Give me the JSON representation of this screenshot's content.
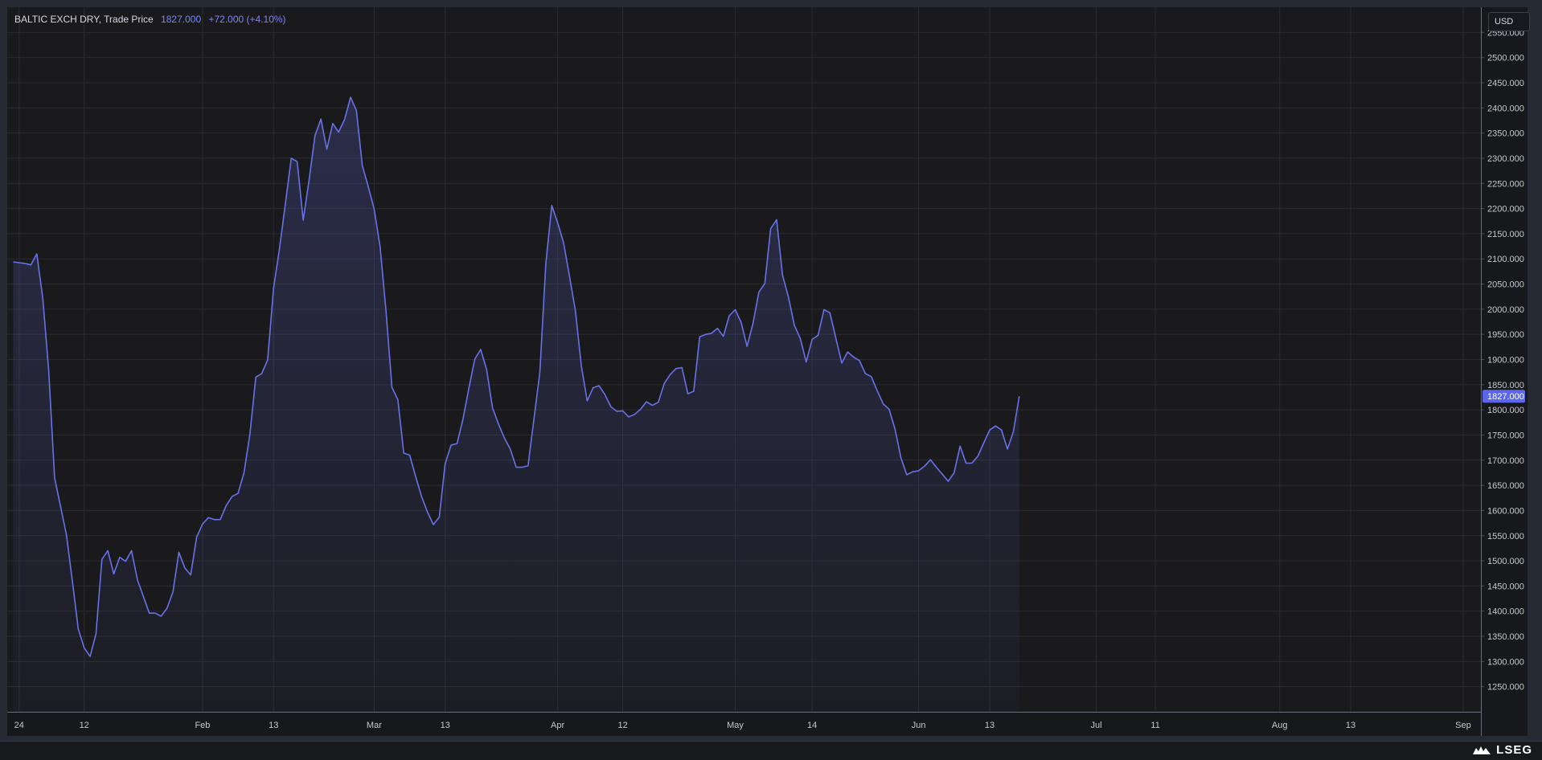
{
  "legend": {
    "symbol": "BALTIC EXCH DRY, Trade Price",
    "last": "1827.000",
    "change": "+72.000 (+4.10%)"
  },
  "currency": "USD",
  "last_price_tag": "1827.000",
  "brand": "LSEG",
  "colors": {
    "line": "#6872e8",
    "background": "#1a1a1d",
    "grid": "#2a2b31",
    "text": "#c4c8d0",
    "price_tag": "#5b66ea"
  },
  "chart_data": {
    "type": "area",
    "title": "BALTIC EXCH DRY, Trade Price",
    "ylabel": "",
    "xlabel": "",
    "ylim": [
      1200,
      2600
    ],
    "grid": true,
    "y_ticks": [
      "1250.000",
      "1300.000",
      "1350.000",
      "1400.000",
      "1450.000",
      "1500.000",
      "1550.000",
      "1600.000",
      "1650.000",
      "1700.000",
      "1750.000",
      "1800.000",
      "1850.000",
      "1900.000",
      "1950.000",
      "2000.000",
      "2050.000",
      "2100.000",
      "2150.000",
      "2200.000",
      "2250.000",
      "2300.000",
      "2350.000",
      "2400.000",
      "2450.000",
      "2500.000",
      "2550.000"
    ],
    "x_ticks": [
      {
        "label": "24",
        "date": "2024-01-01"
      },
      {
        "label": "12",
        "date": "2024-01-12"
      },
      {
        "label": "Feb",
        "date": "2024-02-01"
      },
      {
        "label": "13",
        "date": "2024-02-13"
      },
      {
        "label": "Mar",
        "date": "2024-03-01"
      },
      {
        "label": "13",
        "date": "2024-03-13"
      },
      {
        "label": "Apr",
        "date": "2024-04-01"
      },
      {
        "label": "12",
        "date": "2024-04-12"
      },
      {
        "label": "May",
        "date": "2024-05-01"
      },
      {
        "label": "14",
        "date": "2024-05-14"
      },
      {
        "label": "Jun",
        "date": "2024-06-01"
      },
      {
        "label": "13",
        "date": "2024-06-13"
      },
      {
        "label": "Jul",
        "date": "2024-07-01"
      },
      {
        "label": "11",
        "date": "2024-07-11"
      },
      {
        "label": "Aug",
        "date": "2024-08-01"
      },
      {
        "label": "13",
        "date": "2024-08-13"
      },
      {
        "label": "Sep",
        "date": "2024-09-01"
      }
    ],
    "x_range": [
      "2023-12-30",
      "2024-09-04"
    ],
    "series": [
      {
        "values": [
          [
            "2023-12-31",
            2094
          ],
          [
            "2024-01-02",
            2091
          ],
          [
            "2024-01-03",
            2088
          ],
          [
            "2024-01-04",
            2110
          ],
          [
            "2024-01-05",
            2022
          ],
          [
            "2024-01-06",
            1880
          ],
          [
            "2024-01-07",
            1665
          ],
          [
            "2024-01-09",
            1552
          ],
          [
            "2024-01-10",
            1460
          ],
          [
            "2024-01-11",
            1365
          ],
          [
            "2024-01-12",
            1327
          ],
          [
            "2024-01-13",
            1310
          ],
          [
            "2024-01-14",
            1355
          ],
          [
            "2024-01-15",
            1503
          ],
          [
            "2024-01-16",
            1520
          ],
          [
            "2024-01-17",
            1474
          ],
          [
            "2024-01-18",
            1507
          ],
          [
            "2024-01-19",
            1499
          ],
          [
            "2024-01-20",
            1520
          ],
          [
            "2024-01-21",
            1462
          ],
          [
            "2024-01-23",
            1396
          ],
          [
            "2024-01-24",
            1396
          ],
          [
            "2024-01-25",
            1390
          ],
          [
            "2024-01-26",
            1406
          ],
          [
            "2024-01-27",
            1438
          ],
          [
            "2024-01-28",
            1517
          ],
          [
            "2024-01-29",
            1486
          ],
          [
            "2024-01-30",
            1472
          ],
          [
            "2024-01-31",
            1547
          ],
          [
            "2024-02-01",
            1573
          ],
          [
            "2024-02-02",
            1586
          ],
          [
            "2024-02-03",
            1582
          ],
          [
            "2024-02-04",
            1582
          ],
          [
            "2024-02-05",
            1610
          ],
          [
            "2024-02-06",
            1628
          ],
          [
            "2024-02-07",
            1634
          ],
          [
            "2024-02-08",
            1675
          ],
          [
            "2024-02-09",
            1751
          ],
          [
            "2024-02-10",
            1865
          ],
          [
            "2024-02-11",
            1872
          ],
          [
            "2024-02-12",
            1899
          ],
          [
            "2024-02-13",
            2042
          ],
          [
            "2024-02-14",
            2120
          ],
          [
            "2024-02-15",
            2210
          ],
          [
            "2024-02-16",
            2300
          ],
          [
            "2024-02-17",
            2293
          ],
          [
            "2024-02-18",
            2177
          ],
          [
            "2024-02-19",
            2256
          ],
          [
            "2024-02-20",
            2345
          ],
          [
            "2024-02-21",
            2378
          ],
          [
            "2024-02-22",
            2318
          ],
          [
            "2024-02-23",
            2369
          ],
          [
            "2024-02-24",
            2352
          ],
          [
            "2024-02-25",
            2377
          ],
          [
            "2024-02-26",
            2421
          ],
          [
            "2024-02-27",
            2395
          ],
          [
            "2024-02-28",
            2285
          ],
          [
            "2024-02-29",
            2244
          ],
          [
            "2024-03-01",
            2199
          ],
          [
            "2024-03-02",
            2124
          ],
          [
            "2024-03-03",
            1997
          ],
          [
            "2024-03-04",
            1845
          ],
          [
            "2024-03-05",
            1820
          ],
          [
            "2024-03-06",
            1714
          ],
          [
            "2024-03-07",
            1710
          ],
          [
            "2024-03-08",
            1668
          ],
          [
            "2024-03-09",
            1628
          ],
          [
            "2024-03-10",
            1597
          ],
          [
            "2024-03-11",
            1572
          ],
          [
            "2024-03-12",
            1587
          ],
          [
            "2024-03-13",
            1693
          ],
          [
            "2024-03-14",
            1730
          ],
          [
            "2024-03-15",
            1733
          ],
          [
            "2024-03-16",
            1781
          ],
          [
            "2024-03-17",
            1843
          ],
          [
            "2024-03-18",
            1901
          ],
          [
            "2024-03-19",
            1920
          ],
          [
            "2024-03-20",
            1880
          ],
          [
            "2024-03-21",
            1804
          ],
          [
            "2024-03-22",
            1772
          ],
          [
            "2024-03-23",
            1744
          ],
          [
            "2024-03-24",
            1722
          ],
          [
            "2024-03-25",
            1686
          ],
          [
            "2024-03-26",
            1686
          ],
          [
            "2024-03-27",
            1689
          ],
          [
            "2024-03-28",
            1782
          ],
          [
            "2024-03-29",
            1875
          ],
          [
            "2024-03-30",
            2090
          ],
          [
            "2024-03-31",
            2206
          ],
          [
            "2024-04-01",
            2172
          ],
          [
            "2024-04-02",
            2132
          ],
          [
            "2024-04-03",
            2066
          ],
          [
            "2024-04-04",
            1997
          ],
          [
            "2024-04-05",
            1887
          ],
          [
            "2024-04-06",
            1818
          ],
          [
            "2024-04-07",
            1844
          ],
          [
            "2024-04-08",
            1848
          ],
          [
            "2024-04-09",
            1830
          ],
          [
            "2024-04-10",
            1806
          ],
          [
            "2024-04-11",
            1797
          ],
          [
            "2024-04-12",
            1798
          ],
          [
            "2024-04-13",
            1786
          ],
          [
            "2024-04-14",
            1791
          ],
          [
            "2024-04-15",
            1801
          ],
          [
            "2024-04-16",
            1816
          ],
          [
            "2024-04-17",
            1809
          ],
          [
            "2024-04-18",
            1815
          ],
          [
            "2024-04-19",
            1852
          ],
          [
            "2024-04-20",
            1870
          ],
          [
            "2024-04-21",
            1882
          ],
          [
            "2024-04-22",
            1884
          ],
          [
            "2024-04-23",
            1832
          ],
          [
            "2024-04-24",
            1837
          ],
          [
            "2024-04-25",
            1945
          ],
          [
            "2024-04-26",
            1950
          ],
          [
            "2024-04-27",
            1952
          ],
          [
            "2024-04-28",
            1962
          ],
          [
            "2024-04-29",
            1946
          ],
          [
            "2024-04-30",
            1987
          ],
          [
            "2024-05-01",
            1999
          ],
          [
            "2024-05-02",
            1974
          ],
          [
            "2024-05-03",
            1926
          ],
          [
            "2024-05-04",
            1971
          ],
          [
            "2024-05-05",
            2034
          ],
          [
            "2024-05-06",
            2051
          ],
          [
            "2024-05-07",
            2160
          ],
          [
            "2024-05-08",
            2178
          ],
          [
            "2024-05-09",
            2068
          ],
          [
            "2024-05-10",
            2024
          ],
          [
            "2024-05-11",
            1968
          ],
          [
            "2024-05-12",
            1942
          ],
          [
            "2024-05-13",
            1895
          ],
          [
            "2024-05-14",
            1940
          ],
          [
            "2024-05-15",
            1948
          ],
          [
            "2024-05-16",
            1999
          ],
          [
            "2024-05-17",
            1993
          ],
          [
            "2024-05-18",
            1943
          ],
          [
            "2024-05-19",
            1893
          ],
          [
            "2024-05-20",
            1915
          ],
          [
            "2024-05-21",
            1905
          ],
          [
            "2024-05-22",
            1898
          ],
          [
            "2024-05-23",
            1872
          ],
          [
            "2024-05-24",
            1866
          ],
          [
            "2024-05-25",
            1838
          ],
          [
            "2024-05-26",
            1812
          ],
          [
            "2024-05-27",
            1801
          ],
          [
            "2024-05-28",
            1762
          ],
          [
            "2024-05-29",
            1705
          ],
          [
            "2024-05-30",
            1671
          ],
          [
            "2024-05-31",
            1677
          ],
          [
            "2024-06-01",
            1679
          ],
          [
            "2024-06-02",
            1688
          ],
          [
            "2024-06-03",
            1701
          ],
          [
            "2024-06-04",
            1686
          ],
          [
            "2024-06-05",
            1672
          ],
          [
            "2024-06-06",
            1658
          ],
          [
            "2024-06-07",
            1675
          ],
          [
            "2024-06-08",
            1728
          ],
          [
            "2024-06-09",
            1694
          ],
          [
            "2024-06-10",
            1694
          ],
          [
            "2024-06-11",
            1708
          ],
          [
            "2024-06-12",
            1734
          ],
          [
            "2024-06-13",
            1760
          ],
          [
            "2024-06-14",
            1768
          ],
          [
            "2024-06-15",
            1760
          ],
          [
            "2024-06-16",
            1722
          ],
          [
            "2024-06-17",
            1756
          ],
          [
            "2024-06-18",
            1827
          ]
        ]
      }
    ]
  }
}
